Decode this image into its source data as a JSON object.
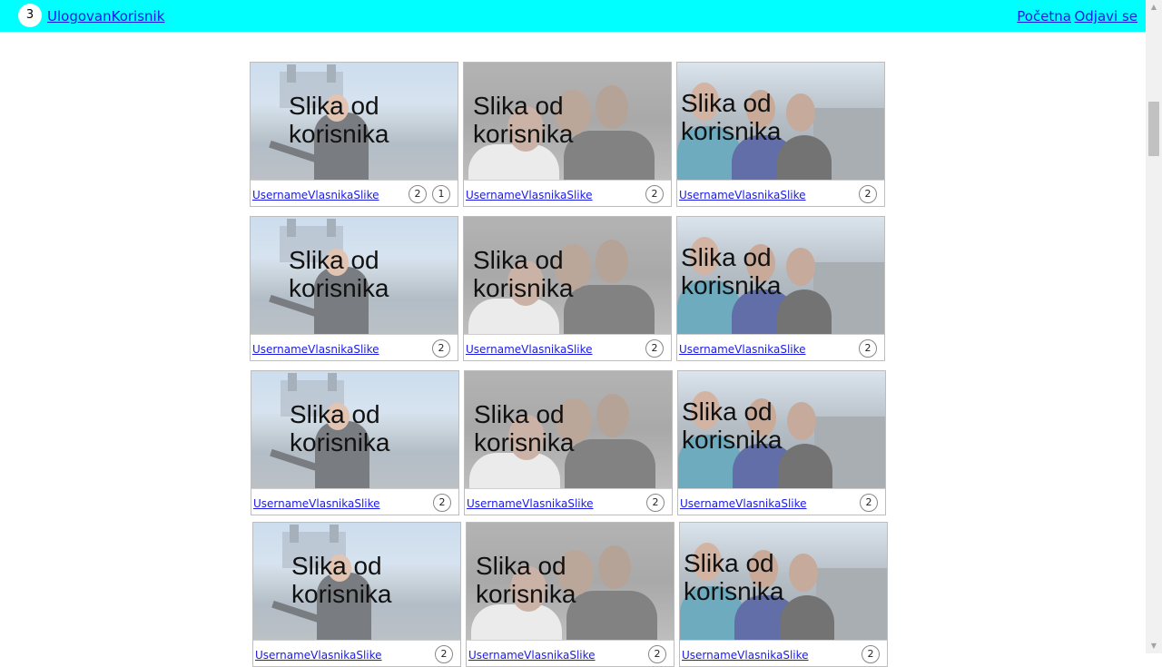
{
  "header": {
    "badge_count": "3",
    "user_link": "UlogovanKorisnik",
    "home_link": "Početna",
    "logout_link": "Odjavi se"
  },
  "gallery": {
    "caption": "Slika od korisnika",
    "caption_line1": "Slika od",
    "caption_line2": "korisnika",
    "owner_label": "UsernameVlasnikaSlike",
    "cards": [
      {
        "photo": "tower-bridge-photo",
        "counts": [
          "2",
          "1"
        ]
      },
      {
        "photo": "group-selfie-photo",
        "counts": [
          "2"
        ]
      },
      {
        "photo": "rooftop-friends-photo",
        "counts": [
          "2"
        ]
      },
      {
        "photo": "tower-bridge-photo",
        "counts": [
          "2"
        ]
      },
      {
        "photo": "group-selfie-photo",
        "counts": [
          "2"
        ]
      },
      {
        "photo": "rooftop-friends-photo",
        "counts": [
          "2"
        ]
      },
      {
        "photo": "tower-bridge-photo",
        "counts": [
          "2"
        ]
      },
      {
        "photo": "group-selfie-photo",
        "counts": [
          "2"
        ]
      },
      {
        "photo": "rooftop-friends-photo",
        "counts": [
          "2"
        ]
      },
      {
        "photo": "tower-bridge-photo",
        "counts": [
          "2"
        ]
      },
      {
        "photo": "group-selfie-photo",
        "counts": [
          "2"
        ]
      },
      {
        "photo": "rooftop-friends-photo",
        "counts": [
          "2"
        ]
      }
    ]
  }
}
